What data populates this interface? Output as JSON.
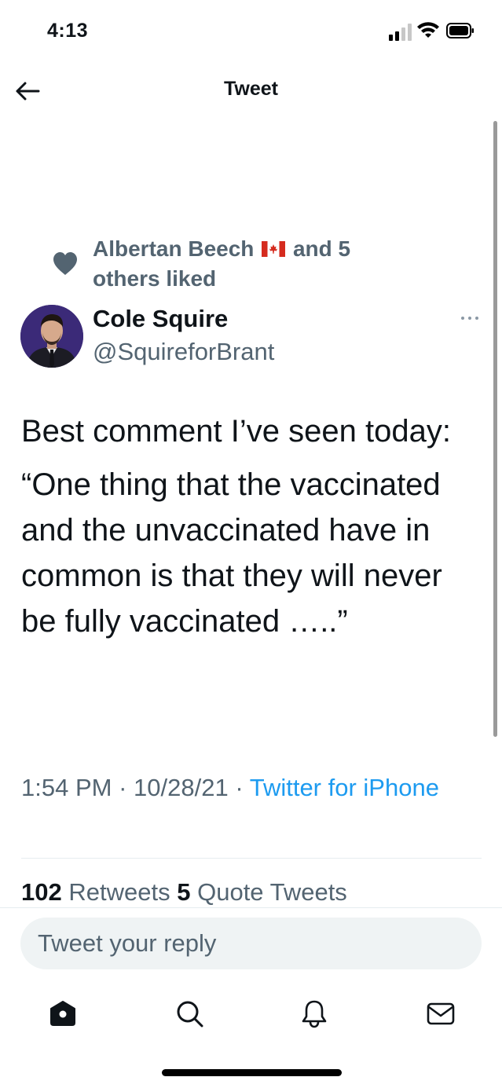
{
  "status_bar": {
    "time": "4:13"
  },
  "header": {
    "title": "Tweet"
  },
  "social_context": {
    "text_before_flag": "Albertan Beech",
    "text_after_flag": "and 5 others liked"
  },
  "author": {
    "name": "Cole Squire",
    "handle": "@SquireforBrant"
  },
  "tweet": {
    "paragraphs": [
      "Best comment I’ve seen today:",
      "“One thing that the vaccinated and the unvaccinated have in common is that they will never be fully vaccinated …..”"
    ],
    "time": "1:54 PM",
    "date": "10/28/21",
    "separator": "·",
    "source": "Twitter for iPhone"
  },
  "stats": {
    "retweets_count": "102",
    "retweets_label": "Retweets",
    "quotes_count": "5",
    "quotes_label": "Quote Tweets"
  },
  "reply": {
    "placeholder": "Tweet your reply"
  },
  "nav": {
    "items": [
      {
        "icon": "home-icon"
      },
      {
        "icon": "search-icon"
      },
      {
        "icon": "bell-icon"
      },
      {
        "icon": "mail-icon"
      }
    ]
  },
  "colors": {
    "text_primary": "#0f1419",
    "text_secondary": "#536471",
    "link": "#1d9bf0",
    "divider": "#e6ecf0",
    "input_bg": "#eff3f4"
  }
}
